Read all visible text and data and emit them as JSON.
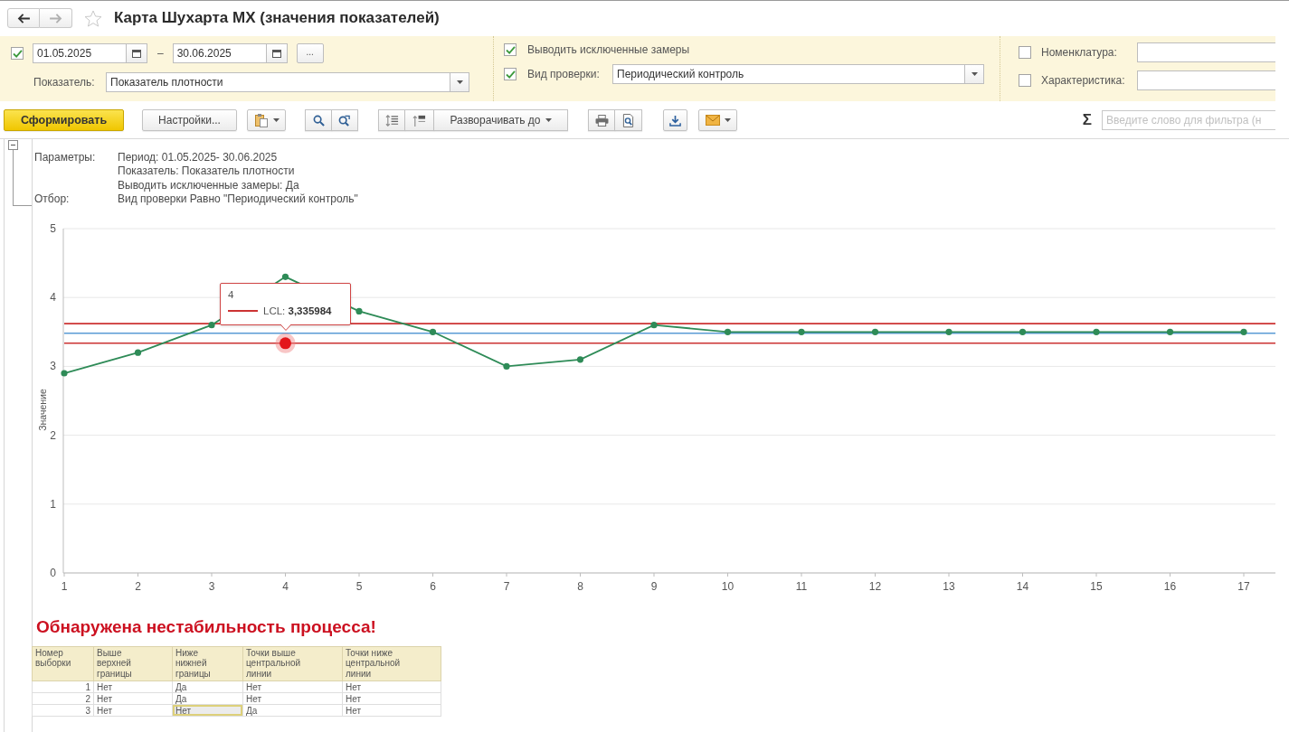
{
  "navigation": {
    "back": {
      "disabled": false
    },
    "forward": {
      "disabled": true
    }
  },
  "window": {
    "title": "Карта Шухарта МХ (значения показателей)",
    "favorite": false
  },
  "filters": {
    "period": {
      "checked": true,
      "from": "01.05.2025",
      "separator": "–",
      "to": "30.06.2025",
      "more": "..."
    },
    "indicator": {
      "label": "Показатель:",
      "value": "Показатель плотности"
    },
    "show_excluded": {
      "checked": true,
      "label": "Выводить исключенные замеры"
    },
    "check_type": {
      "checked": true,
      "label": "Вид проверки:",
      "value": "Периодический контроль"
    },
    "nomenclature": {
      "checked": false,
      "label": "Номенклатура:"
    },
    "characteristic": {
      "checked": false,
      "label": "Характеристика:"
    }
  },
  "toolbar": {
    "generate": "Сформировать",
    "settings": "Настройки...",
    "expand_to": "Разворачивать до",
    "sum_symbol": "Σ",
    "filter": {
      "placeholder": "Введите слово для фильтра (н"
    }
  },
  "report": {
    "group_expanded": true,
    "parameters": [
      {
        "label": "Параметры:",
        "values": [
          "Период: 01.05.2025- 30.06.2025",
          "Показатель: Показатель плотности",
          "Выводить исключенные замеры: Да"
        ]
      },
      {
        "label": "Отбор:",
        "values": [
          "Вид проверки Равно \"Периодический контроль\""
        ]
      }
    ],
    "chart": {
      "chart_data": [
        {
          "type": "line",
          "ylabel": "Значение",
          "categories": [
            "1",
            "2",
            "3",
            "4",
            "5",
            "6",
            "7",
            "8",
            "9",
            "10",
            "11",
            "12",
            "13",
            "14",
            "15",
            "16",
            "17"
          ],
          "series": [
            {
              "color": "#2e8b57",
              "values": [
                2.9,
                3.2,
                3.6,
                4.3,
                3.8,
                3.5,
                3.0,
                3.1,
                3.6,
                3.5,
                3.5,
                3.5,
                3.5,
                3.5,
                3.5,
                3.5,
                3.5
              ]
            }
          ],
          "ylim": [
            0,
            5
          ],
          "yticks": [
            0,
            1,
            2,
            3,
            4,
            5
          ],
          "grid": true,
          "marker": "circle",
          "ref_lines": [
            {
              "axis": "y",
              "value": 3.62,
              "color": "#cc3333"
            },
            {
              "axis": "y",
              "value": 3.48,
              "color": "#5b9bd5"
            },
            {
              "axis": "y",
              "value": 3.336,
              "color": "#cc3333"
            }
          ]
        }
      ],
      "tooltip": {
        "title": "4",
        "text": "LCL: **3,335984**"
      }
    },
    "alert": "Обнаружена нестабильность процесса!",
    "table": {
      "columns": [
        "Номер выборки",
        "Выше верхней границы",
        "Ниже нижней границы",
        "Точки выше центральной линии",
        "Точки ниже центральной линии"
      ],
      "rows": [
        {
          "cells": [
            {
              "text": "1",
              "selected": false
            },
            {
              "text": "Нет",
              "selected": false
            },
            {
              "text": "Да",
              "selected": false
            },
            {
              "text": "Нет",
              "selected": false
            },
            {
              "text": "Нет",
              "selected": false
            }
          ]
        },
        {
          "cells": [
            {
              "text": "2",
              "selected": false
            },
            {
              "text": "Нет",
              "selected": false
            },
            {
              "text": "Да",
              "selected": false
            },
            {
              "text": "Нет",
              "selected": false
            },
            {
              "text": "Нет",
              "selected": false
            }
          ]
        },
        {
          "cells": [
            {
              "text": "3",
              "selected": false
            },
            {
              "text": "Нет",
              "selected": false
            },
            {
              "text": "Нет",
              "selected": true
            },
            {
              "text": "Да",
              "selected": false
            },
            {
              "text": "Нет",
              "selected": false
            }
          ]
        }
      ]
    }
  }
}
